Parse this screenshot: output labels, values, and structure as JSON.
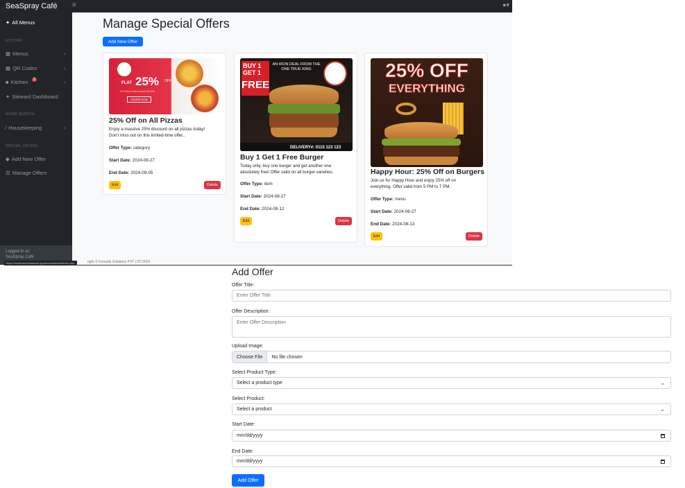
{
  "app": {
    "brand": "SeaSpray Café"
  },
  "sidebar": {
    "all_menus": "All Menus",
    "kitchen_head": "KITCHEN",
    "menus": "Menus",
    "qr_codes": "QR Codes",
    "kitchen": "Kitchen",
    "kitchen_badge": "3",
    "steward": "Steward Dashboard",
    "room_head": "ROOM SERVICE",
    "housekeeping": "Housekeeping",
    "offers_head": "SPECIAL OFFERS",
    "add_offer": "Add New Offer",
    "manage_offers": "Manage Offers",
    "logged_label": "Logged in as:",
    "logged_user": "SeaSpray Café"
  },
  "main": {
    "title": "Manage Special Offers",
    "add_button": "Add New Offer",
    "edit_label": "Edit",
    "delete_label": "Delete",
    "offer_type_label": "Offer Type:",
    "start_label": "Start Date:",
    "end_label": "End Date:",
    "cards": [
      {
        "title": "25% Off on All Pizzas",
        "desc1": "Enjoy a massive 25% discount on all pizzas today!",
        "desc2": "Don't miss out on this limited-time offer..",
        "type": "category",
        "start": "2024-08-27",
        "end": "2024-09-05",
        "img_line1": "FLAT",
        "img_line2": "25%",
        "img_line3": "OFF",
        "img_line4": "On Pizza Orders Above Rs.500",
        "img_btn": "ORDER NOW"
      },
      {
        "title": "Buy 1 Get 1 Free Burger",
        "desc1": "Today only, buy one burger and get another one",
        "desc2": "absolutely free! Offer valid on all burger varieties.",
        "type": "item",
        "start": "2024-08-27",
        "end": "2024-08-12",
        "img_line1": "BUY 1",
        "img_line2": "GET 1",
        "img_line3": "FREE",
        "img_line4": "AN IRON DEAL FROM THE ONE TRUE KING",
        "img_btn": "DELIVERY#: 0115 123 123"
      },
      {
        "title": "Happy Hour: 25% Off on Burgers",
        "desc1": "Join us for Happy Hour and enjoy 25% off on",
        "desc2": "everything. Offer valid from 5 PM to 7 PM.",
        "type": "menu",
        "start": "2024-08-27",
        "end": "2024-08-13",
        "img_line1": "25% OFF",
        "img_line2": "EVERYTHING"
      }
    ]
  },
  "footer": {
    "text": "right © Knoweb Solutions PVT LTD 2024",
    "url": "https://localhost/restaurant-app/menus/admin/index.php"
  },
  "form": {
    "heading": "Add Offer",
    "title_label": "Offer Title:",
    "title_placeholder": "Enter Offer Title",
    "desc_label": "Offer Description:",
    "desc_placeholder": "Enter Offer Description",
    "image_label": "Upload Image:",
    "choose_file": "Choose File",
    "no_file": "No file chosen",
    "ptype_label": "Select Product Type:",
    "ptype_value": "Select a product type",
    "product_label": "Select Product:",
    "product_value": "Select a product",
    "start_label": "Start Date:",
    "start_value": "mm/dd/yyyy",
    "end_label": "End Date:",
    "end_value": "mm/dd/yyyy",
    "submit": "Add Offer"
  },
  "colors": {
    "primary": "#0d6efd",
    "warning": "#ffc107",
    "danger": "#dc3545",
    "dark": "#212529"
  }
}
